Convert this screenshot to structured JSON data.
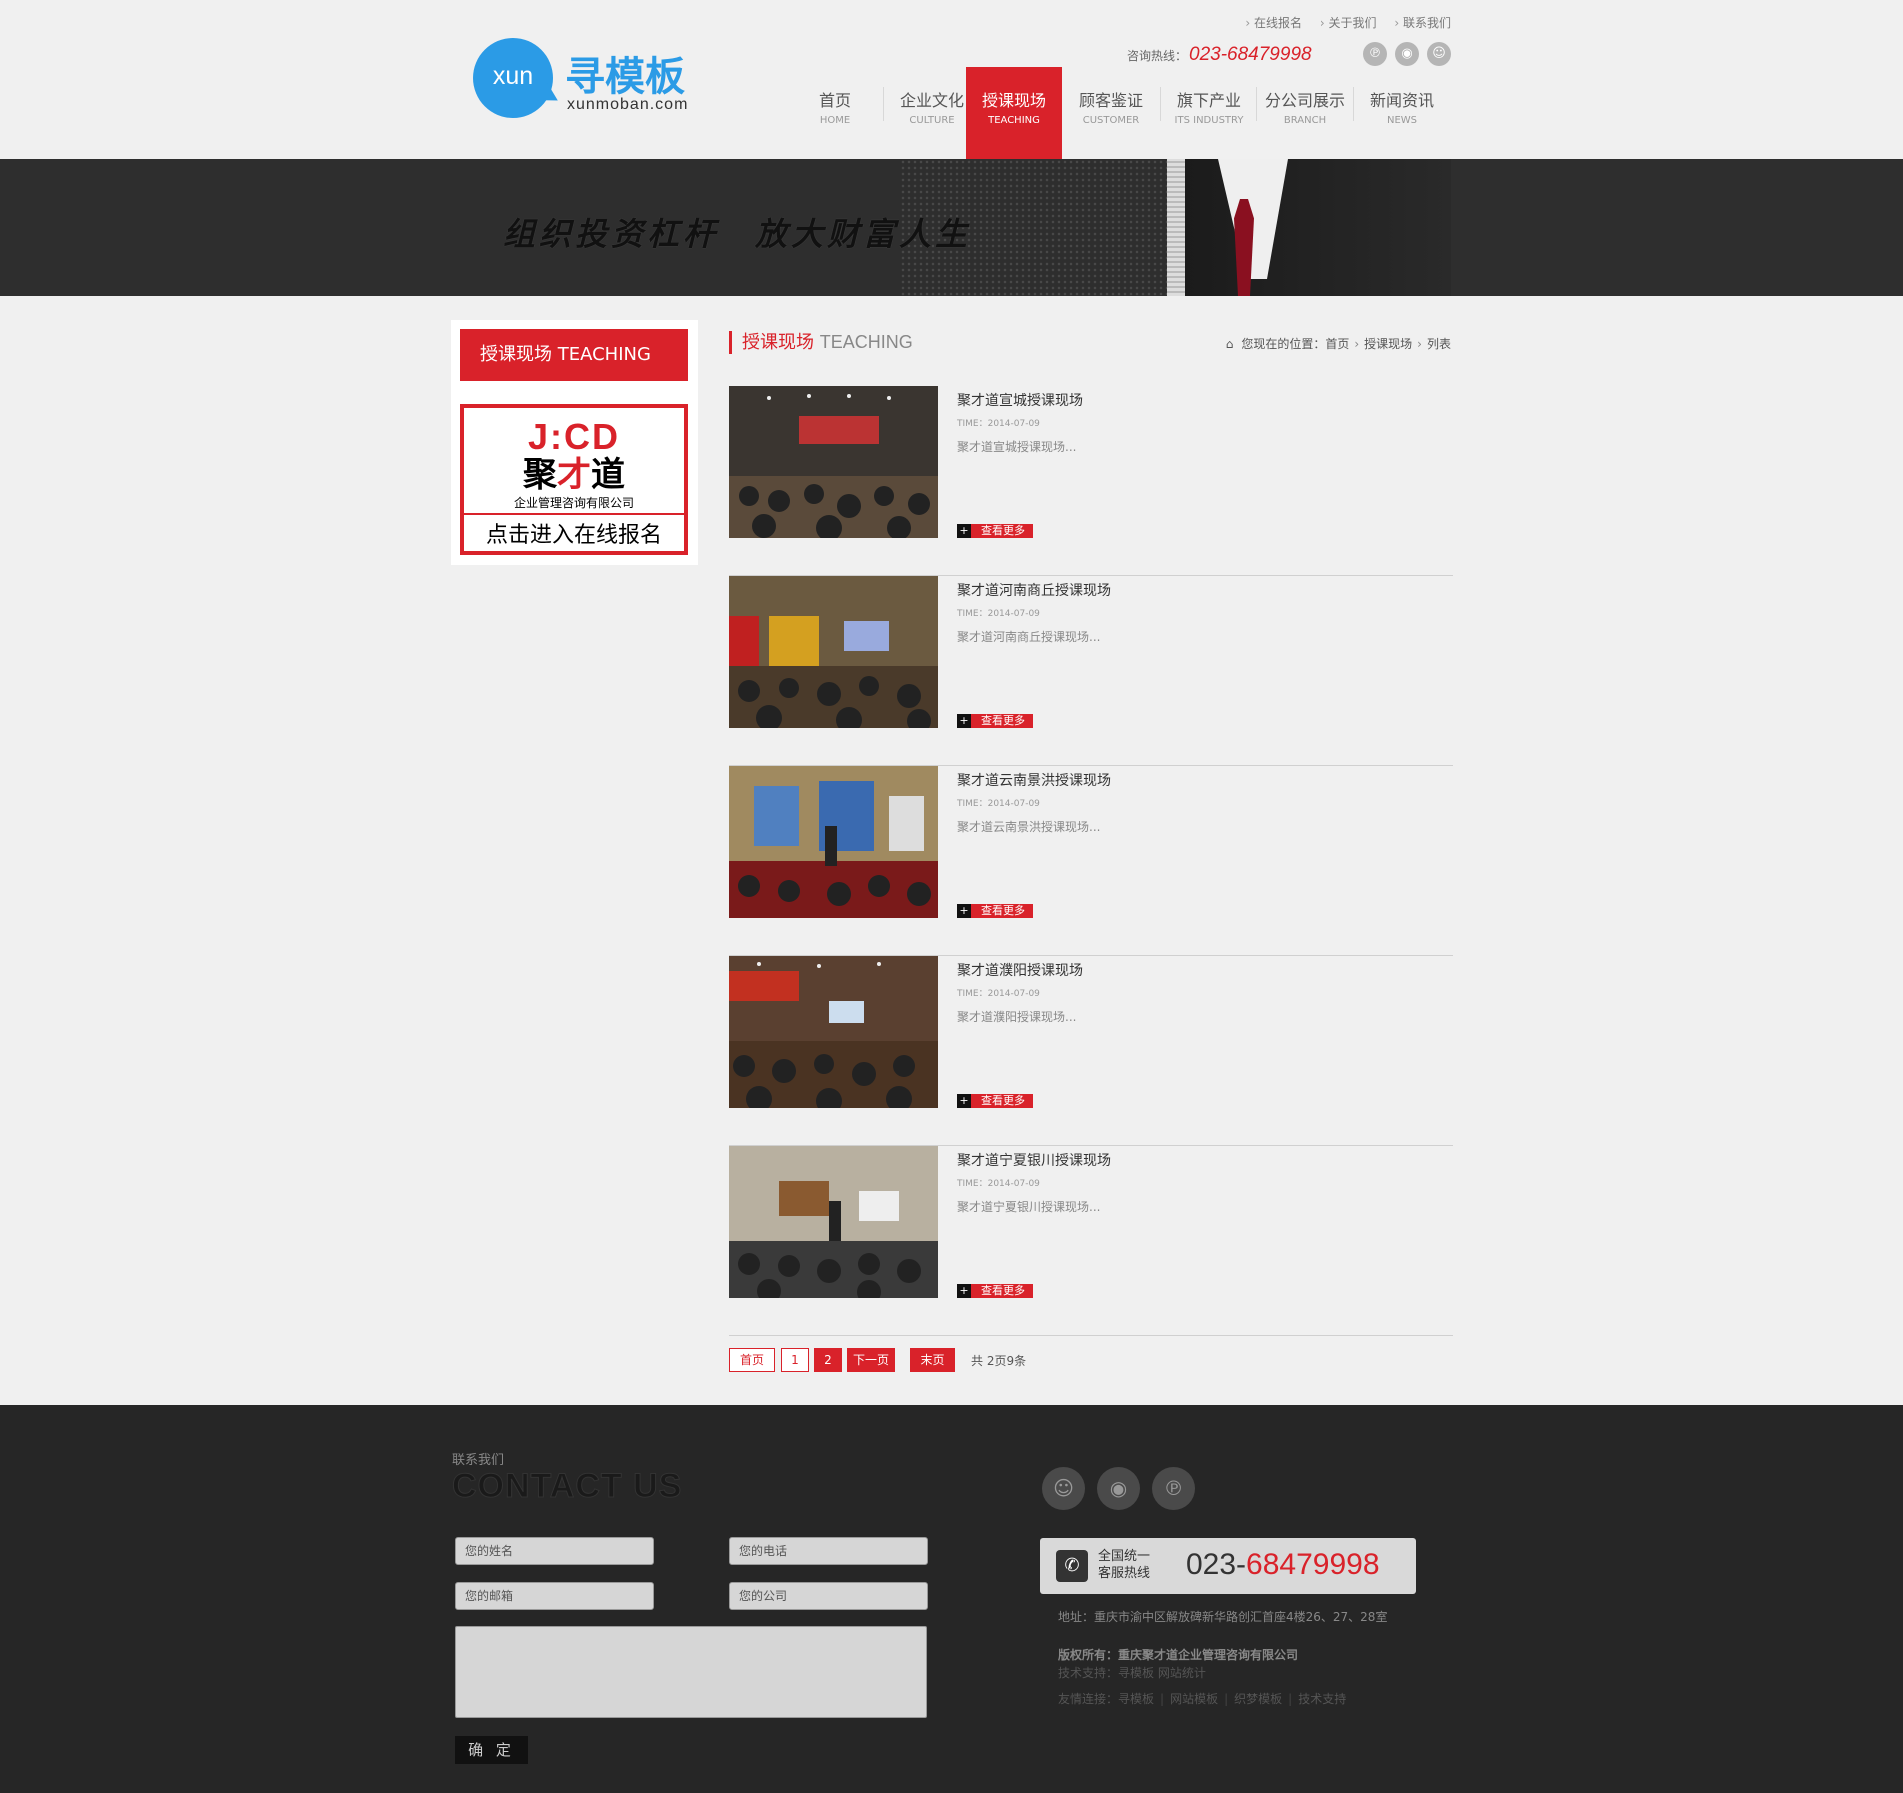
{
  "logo": {
    "circle_text": "xun",
    "name": "寻模板",
    "domain": "xunmoban.com"
  },
  "top_links": [
    "在线报名",
    "关于我们",
    "联系我们"
  ],
  "hotline": {
    "label": "咨询热线：",
    "number": "023-68479998"
  },
  "nav": [
    {
      "cn": "首页",
      "en": "HOME",
      "active": false
    },
    {
      "cn": "企业文化",
      "en": "CULTURE",
      "active": false
    },
    {
      "cn": "授课现场",
      "en": "TEACHING",
      "active": true
    },
    {
      "cn": "顾客鉴证",
      "en": "CUSTOMER",
      "active": false
    },
    {
      "cn": "旗下产业",
      "en": "ITS INDUSTRY",
      "active": false
    },
    {
      "cn": "分公司展示",
      "en": "BRANCH",
      "active": false
    },
    {
      "cn": "新闻资讯",
      "en": "NEWS",
      "active": false
    }
  ],
  "banner": {
    "slogan": "组织投资杠杆　放大财富人生"
  },
  "sidebar": {
    "title": "授课现场 TEACHING",
    "ad": {
      "logo": "J:CD",
      "brand_a": "聚",
      "brand_b": "才",
      "brand_c": "道",
      "company": "企业管理咨询有限公司",
      "cta": "点击进入在线报名"
    }
  },
  "section": {
    "title_cn": "授课现场",
    "title_en": "TEACHING"
  },
  "breadcrumb": {
    "prefix": "您现在的位置：",
    "items": [
      "首页",
      "授课现场",
      "列表"
    ]
  },
  "articles": [
    {
      "title": "聚才道宣城授课现场",
      "time": "TIME：2014-07-09",
      "desc": "聚才道宣城授课现场...",
      "more": "查看更多"
    },
    {
      "title": "聚才道河南商丘授课现场",
      "time": "TIME：2014-07-09",
      "desc": "聚才道河南商丘授课现场...",
      "more": "查看更多"
    },
    {
      "title": "聚才道云南景洪授课现场",
      "time": "TIME：2014-07-09",
      "desc": "聚才道云南景洪授课现场...",
      "more": "查看更多"
    },
    {
      "title": "聚才道濮阳授课现场",
      "time": "TIME：2014-07-09",
      "desc": "聚才道濮阳授课现场...",
      "more": "查看更多"
    },
    {
      "title": "聚才道宁夏银川授课现场",
      "time": "TIME：2014-07-09",
      "desc": "聚才道宁夏银川授课现场...",
      "more": "查看更多"
    }
  ],
  "pager": {
    "first": "首页",
    "page1": "1",
    "page2": "2",
    "next": "下一页",
    "last": "末页",
    "total": "共 2页9条"
  },
  "footer": {
    "contact_cn": "联系我们",
    "contact_en": "CONTACT US",
    "form": {
      "name": "您的姓名",
      "phone": "您的电话",
      "email": "您的邮箱",
      "company": "您的公司",
      "submit": "确 定"
    },
    "phone": {
      "label1": "全国统一",
      "label2": "客服热线",
      "prefix": "023-",
      "num": "68479998"
    },
    "address": "地址：重庆市渝中区解放碑新华路创汇首座4楼26、27、28室",
    "copyright": "版权所有：重庆聚才道企业管理咨询有限公司",
    "tech": "技术支持：寻模板 网站统计",
    "links_label": "友情连接：",
    "links": [
      "寻模板",
      "网站模板",
      "织梦模板",
      "技术支持"
    ]
  },
  "colors": {
    "accent": "#d9222a",
    "brand_blue": "#2b9be6",
    "footer_bg": "#262626"
  }
}
